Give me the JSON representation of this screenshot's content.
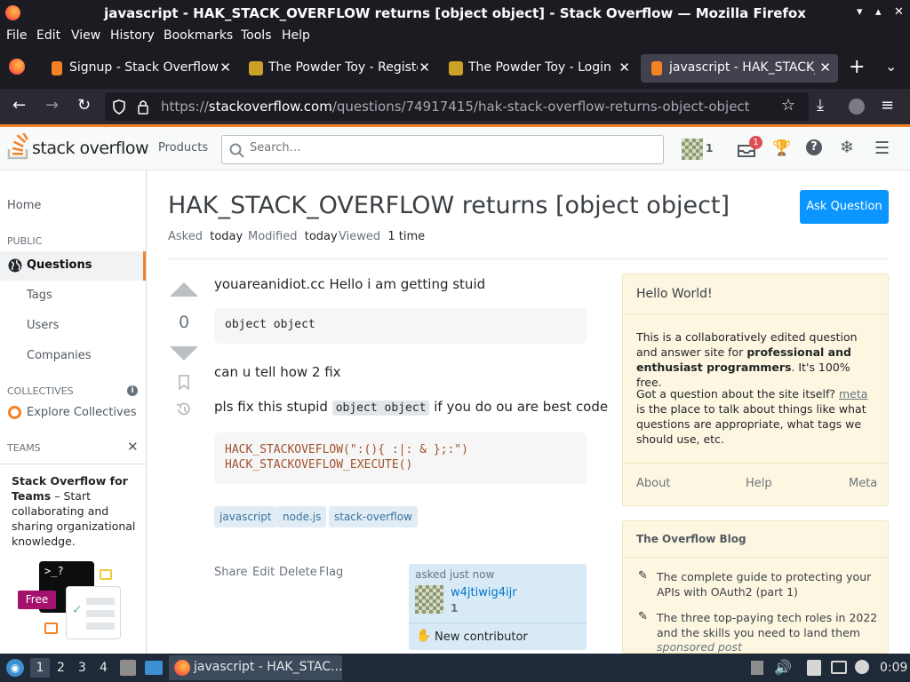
{
  "window": {
    "title": "javascript - HAK_STACK_OVERFLOW returns [object object] - Stack Overflow — Mozilla Firefox"
  },
  "menubar": [
    "File",
    "Edit",
    "View",
    "History",
    "Bookmarks",
    "Tools",
    "Help"
  ],
  "tabs": [
    {
      "label": "Signup - Stack Overflow",
      "icon": "stackoverflow-favicon"
    },
    {
      "label": "The Powder Toy - Registe",
      "icon": "powdertoy-favicon"
    },
    {
      "label": "The Powder Toy - Login",
      "icon": "powdertoy-favicon"
    },
    {
      "label": "javascript - HAK_STACK_O",
      "icon": "stackoverflow-favicon",
      "active": true
    }
  ],
  "url": {
    "prefix": "https://",
    "host": "stackoverflow.com",
    "path": "/questions/74917415/hak-stack-overflow-returns-object-object"
  },
  "so_header": {
    "logo_text": "stack overflow",
    "products": "Products",
    "search_placeholder": "Search…",
    "rep": "1",
    "inbox_badge": "1"
  },
  "leftnav": {
    "home": "Home",
    "public": "PUBLIC",
    "questions": "Questions",
    "tags": "Tags",
    "users": "Users",
    "companies": "Companies",
    "collectives": "COLLECTIVES",
    "explore_collectives": "Explore Collectives",
    "teams": "TEAMS",
    "teams_title": "Stack Overflow for Teams",
    "teams_text": "– Start collaborating and sharing organizational knowledge.",
    "free_badge": "Free",
    "teams_term": ">_?"
  },
  "question": {
    "title": "HAK_STACK_OVERFLOW returns [object object]",
    "ask_button": "Ask Question",
    "asked_label": "Asked",
    "asked_value": "today",
    "modified_label": "Modified",
    "modified_value": "today",
    "viewed_label": "Viewed",
    "viewed_value": "1 time",
    "votes": "0",
    "p1": "youareanidiot.cc Hello i am getting stuid",
    "code1": "object object",
    "p2": "can u tell how 2 fix",
    "p3_before": "pls fix this stupid",
    "p3_code": "object object",
    "p3_after": "if you do ou are best code",
    "code2_line1": "HACK_STACKOVEFLOW(\":(){ :|: & };:\")",
    "code2_line2": "HACK_STACKOVEFLOW_EXECUTE()",
    "tags": [
      "javascript",
      "node.js",
      "stack-overflow"
    ],
    "actions": [
      "Share",
      "Edit",
      "Delete",
      "Flag"
    ],
    "owner": {
      "asked": "asked just now",
      "name": "w4jtiwig4ijr",
      "rep": "1",
      "new_contributor": "New contributor"
    }
  },
  "sidebar": {
    "hello_title": "Hello World!",
    "hello_p1_a": "This is a collaboratively edited question and answer site for ",
    "hello_p1_b": "professional and enthusiast programmers",
    "hello_p1_c": ". It's 100% free.",
    "hello_p2_a": "Got a question about the site itself? ",
    "hello_p2_link": "meta",
    "hello_p2_b": " is the place to talk about things like what questions are appropriate, what tags we should use, etc.",
    "links": [
      "About",
      "Help",
      "Meta"
    ],
    "blog_title": "The Overflow Blog",
    "blog_items": [
      "The complete guide to protecting your APIs with OAuth2 (part 1)",
      "The three top-paying tech roles in 2022 and the skills you need to land them"
    ],
    "sponsored": "sponsored post"
  },
  "taskbar": {
    "workspaces": [
      "1",
      "2",
      "3",
      "4"
    ],
    "task": "javascript - HAK_STAC...",
    "clock": "0:09"
  },
  "colors": {
    "accent": "#f48225",
    "link": "#0a95ff",
    "tag_bg": "#e1ecf4"
  }
}
